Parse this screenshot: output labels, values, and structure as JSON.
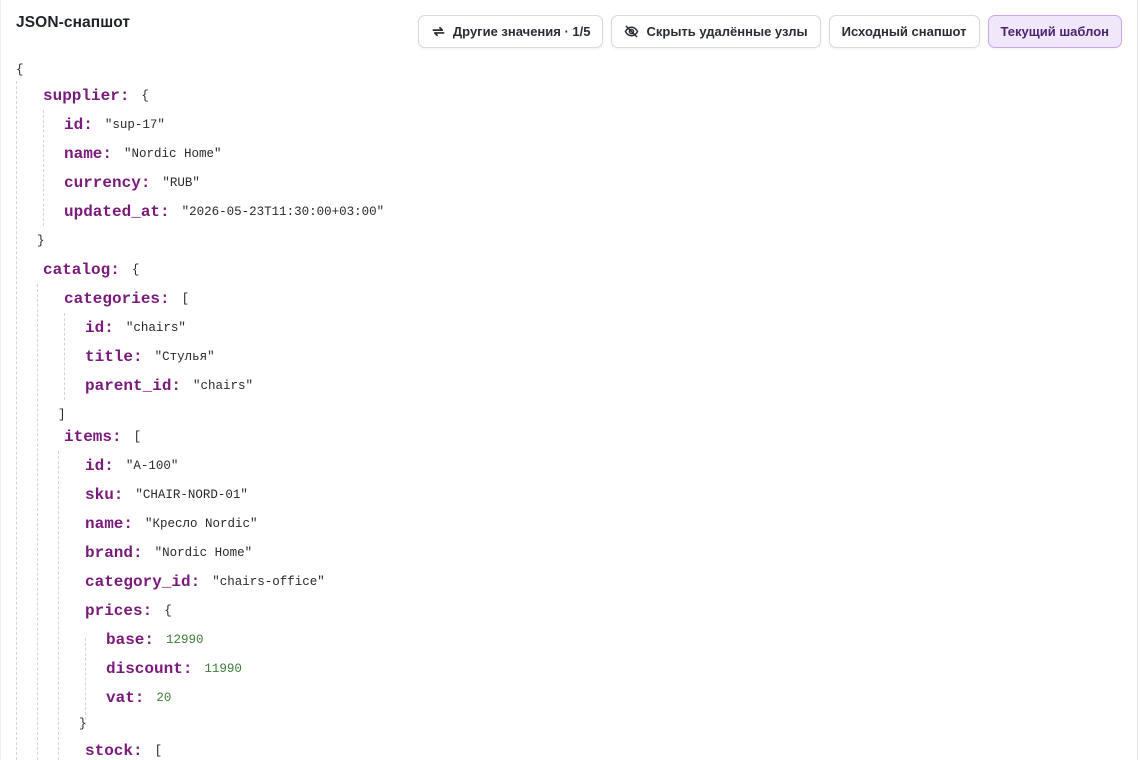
{
  "header": {
    "title": "JSON-снапшот",
    "buttons": {
      "other_values": "Другие значения · 1/5",
      "hide_deleted": "Скрыть удалённые узлы",
      "source_snapshot": "Исходный снапшот",
      "current_template": "Текущий шаблон"
    }
  },
  "tree": {
    "root_open": "{",
    "supplier": {
      "key": "supplier:",
      "open": "{",
      "close": "}",
      "fields": [
        {
          "key": "id:",
          "value": "\"sup-17\""
        },
        {
          "key": "name:",
          "value": "\"Nordic Home\""
        },
        {
          "key": "currency:",
          "value": "\"RUB\""
        },
        {
          "key": "updated_at:",
          "value": "\"2026-05-23T11:30:00+03:00\""
        }
      ]
    },
    "catalog": {
      "key": "catalog:",
      "open": "{",
      "categories": {
        "key": "categories:",
        "open": "[",
        "close": "]",
        "fields": [
          {
            "key": "id:",
            "value": "\"chairs\""
          },
          {
            "key": "title:",
            "value": "\"Стулья\""
          },
          {
            "key": "parent_id:",
            "value": "\"chairs\""
          }
        ]
      },
      "items": {
        "key": "items:",
        "open": "[",
        "fields": [
          {
            "key": "id:",
            "value": "\"A-100\""
          },
          {
            "key": "sku:",
            "value": "\"CHAIR-NORD-01\""
          },
          {
            "key": "name:",
            "value": "\"Кресло Nordic\""
          },
          {
            "key": "brand:",
            "value": "\"Nordic Home\""
          },
          {
            "key": "category_id:",
            "value": "\"chairs-office\""
          }
        ],
        "prices": {
          "key": "prices:",
          "open": "{",
          "close": "}",
          "fields": [
            {
              "key": "base:",
              "value": "12990"
            },
            {
              "key": "discount:",
              "value": "11990"
            },
            {
              "key": "vat:",
              "value": "20"
            }
          ]
        },
        "stock": {
          "key": "stock:",
          "open": "["
        }
      }
    }
  },
  "colors": {
    "key": "#7a1a7a",
    "number": "#3f7d3a",
    "active_button_bg": "#f1e7fb",
    "active_button_border": "#c9a8ea"
  },
  "icons": {
    "other_values": "refresh-icon",
    "hide_deleted": "eye-off-icon"
  }
}
